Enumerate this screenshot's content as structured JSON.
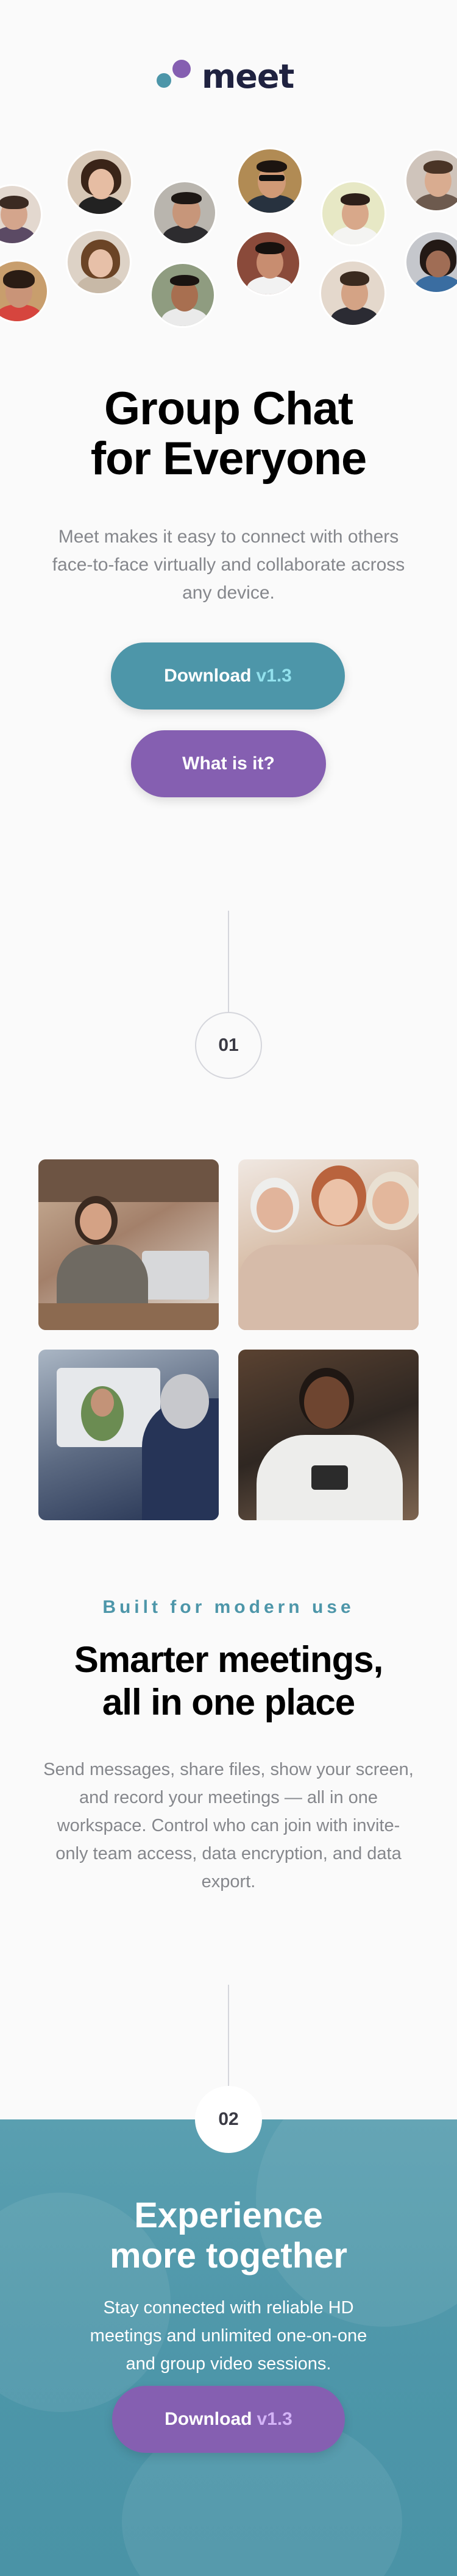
{
  "brand": {
    "name": "meet",
    "colors": {
      "teal": "#4d96a9",
      "purple": "#855fb1",
      "text_gray": "#85878c"
    }
  },
  "hero": {
    "title_line1": "Group Chat",
    "title_line2": "for Everyone",
    "description": "Meet makes it easy to connect with others face-to-face virtually and collaborate across any device.",
    "download_label": "Download",
    "download_version": "v1.3",
    "what_label": "What is it?"
  },
  "avatars": [
    "avatar-1",
    "avatar-2",
    "avatar-3",
    "avatar-4",
    "avatar-5",
    "avatar-6",
    "avatar-7",
    "avatar-8",
    "avatar-9",
    "avatar-10",
    "avatar-11",
    "avatar-12",
    "avatar-13",
    "avatar-14"
  ],
  "steps": {
    "one": "01",
    "two": "02"
  },
  "features": {
    "eyebrow": "Built for modern use",
    "title_line1": "Smarter meetings,",
    "title_line2": "all in one place",
    "description": "Send messages, share files, show your screen, and record your meetings — all in one workspace. Control who can join with invite-only team access, data encryption, and data export."
  },
  "cta": {
    "title_line1": "Experience",
    "title_line2": "more together",
    "description": "Stay connected with reliable HD meetings and unlimited one-on-one and group video sessions.",
    "download_label": "Download",
    "download_version": "v1.3"
  }
}
